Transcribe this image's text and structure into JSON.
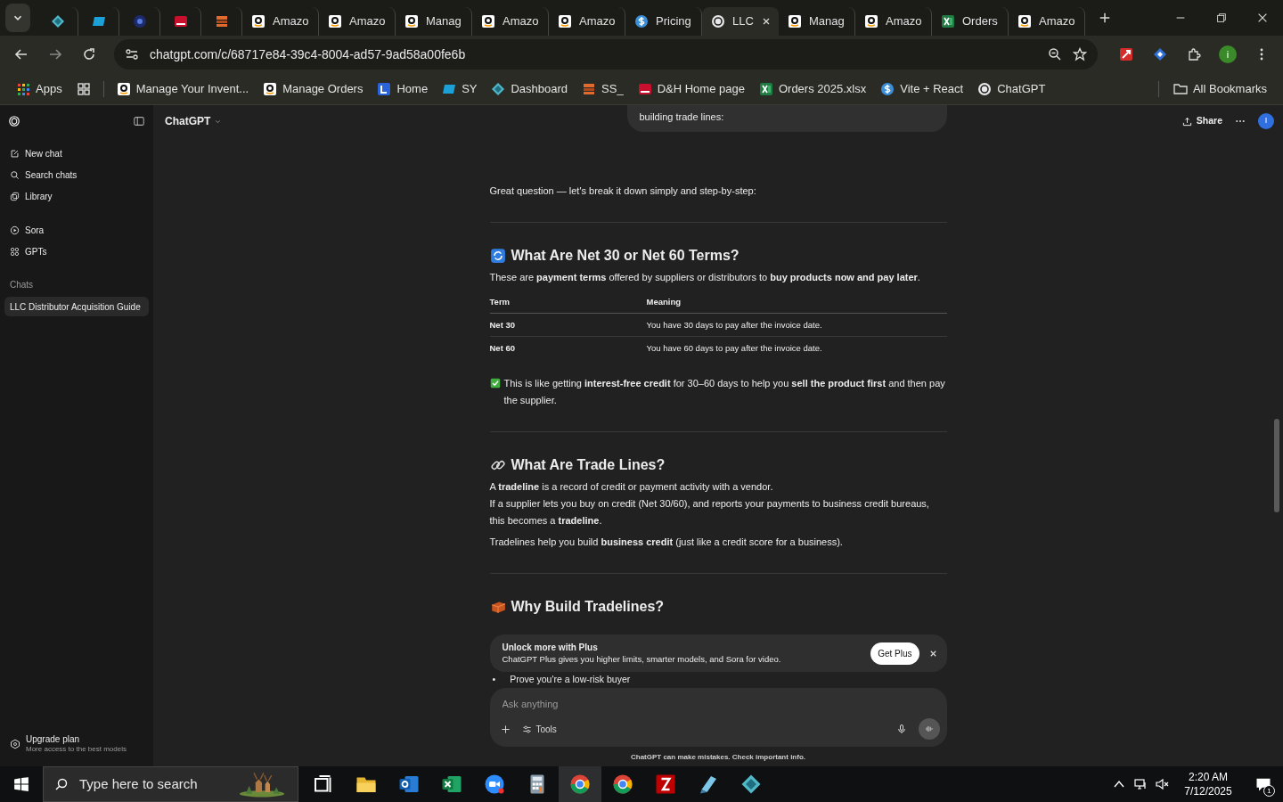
{
  "browser": {
    "tabs": [
      {
        "kind": "diamond",
        "selected": false
      },
      {
        "kind": "ec",
        "selected": false
      },
      {
        "kind": "tw",
        "selected": false
      },
      {
        "kind": "dh",
        "selected": false
      },
      {
        "kind": "boxes",
        "selected": false
      },
      {
        "kind": "amazon",
        "label": "Amazo",
        "selected": false
      },
      {
        "kind": "amazon",
        "label": "Amazo",
        "selected": false
      },
      {
        "kind": "amazon",
        "label": "Manag",
        "selected": false
      },
      {
        "kind": "amazon",
        "label": "Amazo",
        "selected": false
      },
      {
        "kind": "amazon",
        "label": "Amazo",
        "selected": false
      },
      {
        "kind": "dollar",
        "label": "Pricing",
        "selected": false
      },
      {
        "kind": "chatgpt",
        "label": "LLC",
        "selected": true
      },
      {
        "kind": "amazon",
        "label": "Manag",
        "selected": false
      },
      {
        "kind": "amazon",
        "label": "Amazo",
        "selected": false
      },
      {
        "kind": "excel",
        "label": "Orders",
        "selected": false
      },
      {
        "kind": "amazon",
        "label": "Amazo",
        "selected": false
      }
    ],
    "url": "chatgpt.com/c/68717e84-39c4-8004-ad57-9ad58a00fe6b",
    "profile_initial": "i",
    "bookmarks": [
      {
        "kind": "apps",
        "label": "Apps"
      },
      {
        "kind": "grid"
      },
      {
        "kind": "amazon",
        "label": "Manage Your Invent..."
      },
      {
        "kind": "amazon",
        "label": "Manage Orders"
      },
      {
        "kind": "home",
        "label": "Home"
      },
      {
        "kind": "ec",
        "label": "SY"
      },
      {
        "kind": "diamond",
        "label": "Dashboard"
      },
      {
        "kind": "boxes",
        "label": "SS_"
      },
      {
        "kind": "dh",
        "label": "D&H Home page"
      },
      {
        "kind": "excel",
        "label": "Orders 2025.xlsx"
      },
      {
        "kind": "dollar",
        "label": "Vite + React"
      },
      {
        "kind": "chatgpt",
        "label": "ChatGPT"
      }
    ],
    "all_bookmarks": "All Bookmarks"
  },
  "sidebar": {
    "items": [
      {
        "kind": "new",
        "label": "New chat"
      },
      {
        "kind": "search",
        "label": "Search chats"
      },
      {
        "kind": "library",
        "label": "Library"
      },
      {
        "kind": "sora",
        "label": "Sora"
      },
      {
        "kind": "gpts",
        "label": "GPTs"
      }
    ],
    "chats_heading": "Chats",
    "chats": [
      {
        "label": "LLC Distributor Acquisition Guide",
        "selected": true
      }
    ],
    "upgrade": {
      "title": "Upgrade plan",
      "subtitle": "More access to the best models"
    }
  },
  "header": {
    "model": "ChatGPT",
    "share": "Share",
    "avatar_initial": "I"
  },
  "conversation": {
    "user_message": "building trade lines:",
    "blocks": [
      {
        "kind": "paragraph",
        "text": "Great question — let's break it down simply and step-by-step:"
      },
      {
        "kind": "divider"
      },
      {
        "kind": "heading",
        "text": "What Are **Net 30** or **Net 60** Terms?"
      },
      {
        "kind": "paragraph",
        "text": "These are **payment terms** offered by suppliers or distributors to **buy products now and pay later**."
      },
      {
        "kind": "table",
        "columns": [
          "Term",
          "Meaning"
        ],
        "rows": [
          [
            "Net 30",
            "You have 30 days to pay after the invoice date."
          ],
          [
            "Net 60",
            "You have 60 days to pay after the invoice date."
          ]
        ]
      },
      {
        "kind": "note",
        "text": "This is like getting **interest-free credit** for 30–60 days to help you **sell the product first** and then pay the supplier."
      },
      {
        "kind": "divider"
      },
      {
        "kind": "heading",
        "text": "What Are Trade Lines?"
      },
      {
        "kind": "line",
        "text": "A **tradeline** is a record of credit or payment activity with a vendor."
      },
      {
        "kind": "paragraph",
        "text": "If a supplier lets you buy on credit (Net 30/60), and reports your payments to business credit bureaus, this becomes a **tradeline**."
      },
      {
        "kind": "paragraph",
        "text": "Tradelines help you build **business credit** (just like a credit score for a business)."
      },
      {
        "kind": "divider"
      },
      {
        "kind": "heading",
        "text": "Why Build Tradelines?"
      }
    ],
    "bullets": [
      {
        "marker": "•",
        "text": "Prove you're a low-risk buyer"
      }
    ]
  },
  "promo": {
    "title": "Unlock more with Plus",
    "text": "ChatGPT Plus gives you higher limits, smarter models, and Sora for video.",
    "button": "Get Plus"
  },
  "composer": {
    "placeholder": "Ask anything",
    "tools": "Tools",
    "disclaimer": "ChatGPT can make mistakes. Check important info."
  },
  "taskbar": {
    "search_placeholder": "Type here to search",
    "apps": [
      {
        "kind": "taskview",
        "selected": false
      },
      {
        "kind": "explorer",
        "selected": false
      },
      {
        "kind": "outlook",
        "selected": false
      },
      {
        "kind": "excel",
        "selected": false
      },
      {
        "kind": "zoom",
        "selected": false
      },
      {
        "kind": "calculator",
        "selected": false
      },
      {
        "kind": "chrome",
        "selected": true
      },
      {
        "kind": "chrome",
        "selected": false
      },
      {
        "kind": "filezilla",
        "selected": false
      },
      {
        "kind": "notepad",
        "selected": false
      },
      {
        "kind": "diamond",
        "selected": false
      }
    ],
    "time": "2:20 AM",
    "date": "7/12/2025",
    "notifications": "1"
  }
}
